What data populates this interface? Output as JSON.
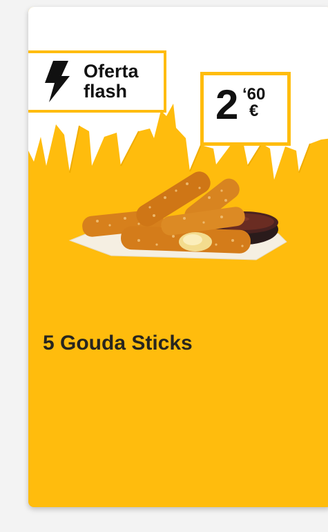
{
  "card": {
    "flash_badge": {
      "line1": "Oferta",
      "line2": "flash"
    },
    "price": {
      "integer": "2",
      "decimals": "‘60",
      "currency": "€"
    },
    "product_name": "5 Gouda Sticks",
    "colors": {
      "brand_yellow": "#ffbc0d",
      "text_dark": "#27251f",
      "page_bg": "#f3f3f3"
    },
    "icons": {
      "flash": "lightning-bolt-icon"
    }
  }
}
